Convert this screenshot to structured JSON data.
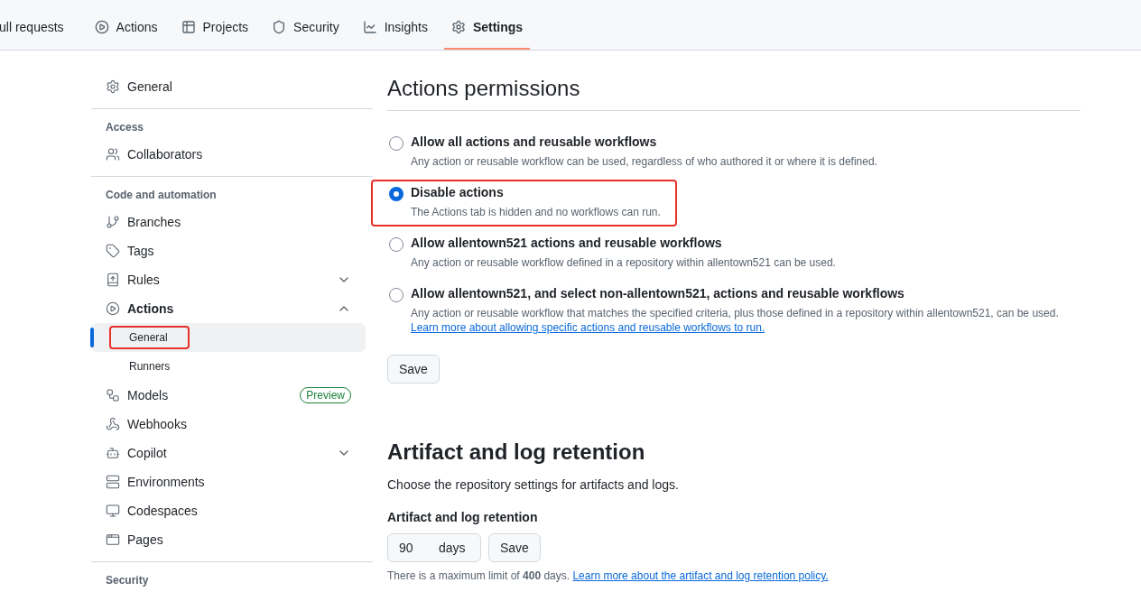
{
  "repo_nav": {
    "tabs": [
      {
        "label": "ull requests",
        "selected": false
      },
      {
        "label": "Actions",
        "selected": false
      },
      {
        "label": "Projects",
        "selected": false
      },
      {
        "label": "Security",
        "selected": false
      },
      {
        "label": "Insights",
        "selected": false
      },
      {
        "label": "Settings",
        "selected": true
      }
    ]
  },
  "sidebar": {
    "sections": [
      {
        "items": [
          {
            "label": "General",
            "selected": false
          }
        ]
      },
      {
        "heading": "Access",
        "items": [
          {
            "label": "Collaborators",
            "selected": false
          }
        ]
      },
      {
        "heading": "Code and automation",
        "items": [
          {
            "label": "Branches",
            "selected": false
          },
          {
            "label": "Tags",
            "selected": false
          },
          {
            "label": "Rules",
            "selected": false,
            "expanded": false
          },
          {
            "label": "Actions",
            "selected": false,
            "expanded": true,
            "children": [
              {
                "label": "General",
                "selected": true,
                "annotated": true
              },
              {
                "label": "Runners",
                "selected": false,
                "annotated": false
              }
            ]
          },
          {
            "label": "Models",
            "selected": false,
            "badge": "Preview"
          },
          {
            "label": "Webhooks",
            "selected": false
          },
          {
            "label": "Copilot",
            "selected": false,
            "expanded": false
          },
          {
            "label": "Environments",
            "selected": false
          },
          {
            "label": "Codespaces",
            "selected": false
          },
          {
            "label": "Pages",
            "selected": false
          }
        ]
      },
      {
        "heading": "Security"
      }
    ]
  },
  "permissions": {
    "title": "Actions permissions",
    "options": [
      {
        "label": "Allow all actions and reusable workflows",
        "description": "Any action or reusable workflow can be used, regardless of who authored it or where it is defined.",
        "selected": false,
        "annotated": false
      },
      {
        "label": "Disable actions",
        "description": "The Actions tab is hidden and no workflows can run.",
        "selected": true,
        "annotated": true
      },
      {
        "label": "Allow allentown521 actions and reusable workflows",
        "description": "Any action or reusable workflow defined in a repository within allentown521 can be used.",
        "selected": false,
        "annotated": false
      },
      {
        "label": "Allow allentown521, and select non-allentown521, actions and reusable workflows",
        "description": "Any action or reusable workflow that matches the specified criteria, plus those defined in a repository within allentown521, can be used.",
        "link": "Learn more about allowing specific actions and reusable workflows to run.",
        "selected": false,
        "annotated": false
      }
    ],
    "save_button": "Save"
  },
  "retention": {
    "title": "Artifact and log retention",
    "description": "Choose the repository settings for artifacts and logs.",
    "field_label": "Artifact and log retention",
    "value": "90",
    "suffix": "days",
    "save_button": "Save",
    "note": "There is a maximum limit of **400** days.",
    "link": "Learn more about the artifact and log retention policy."
  }
}
